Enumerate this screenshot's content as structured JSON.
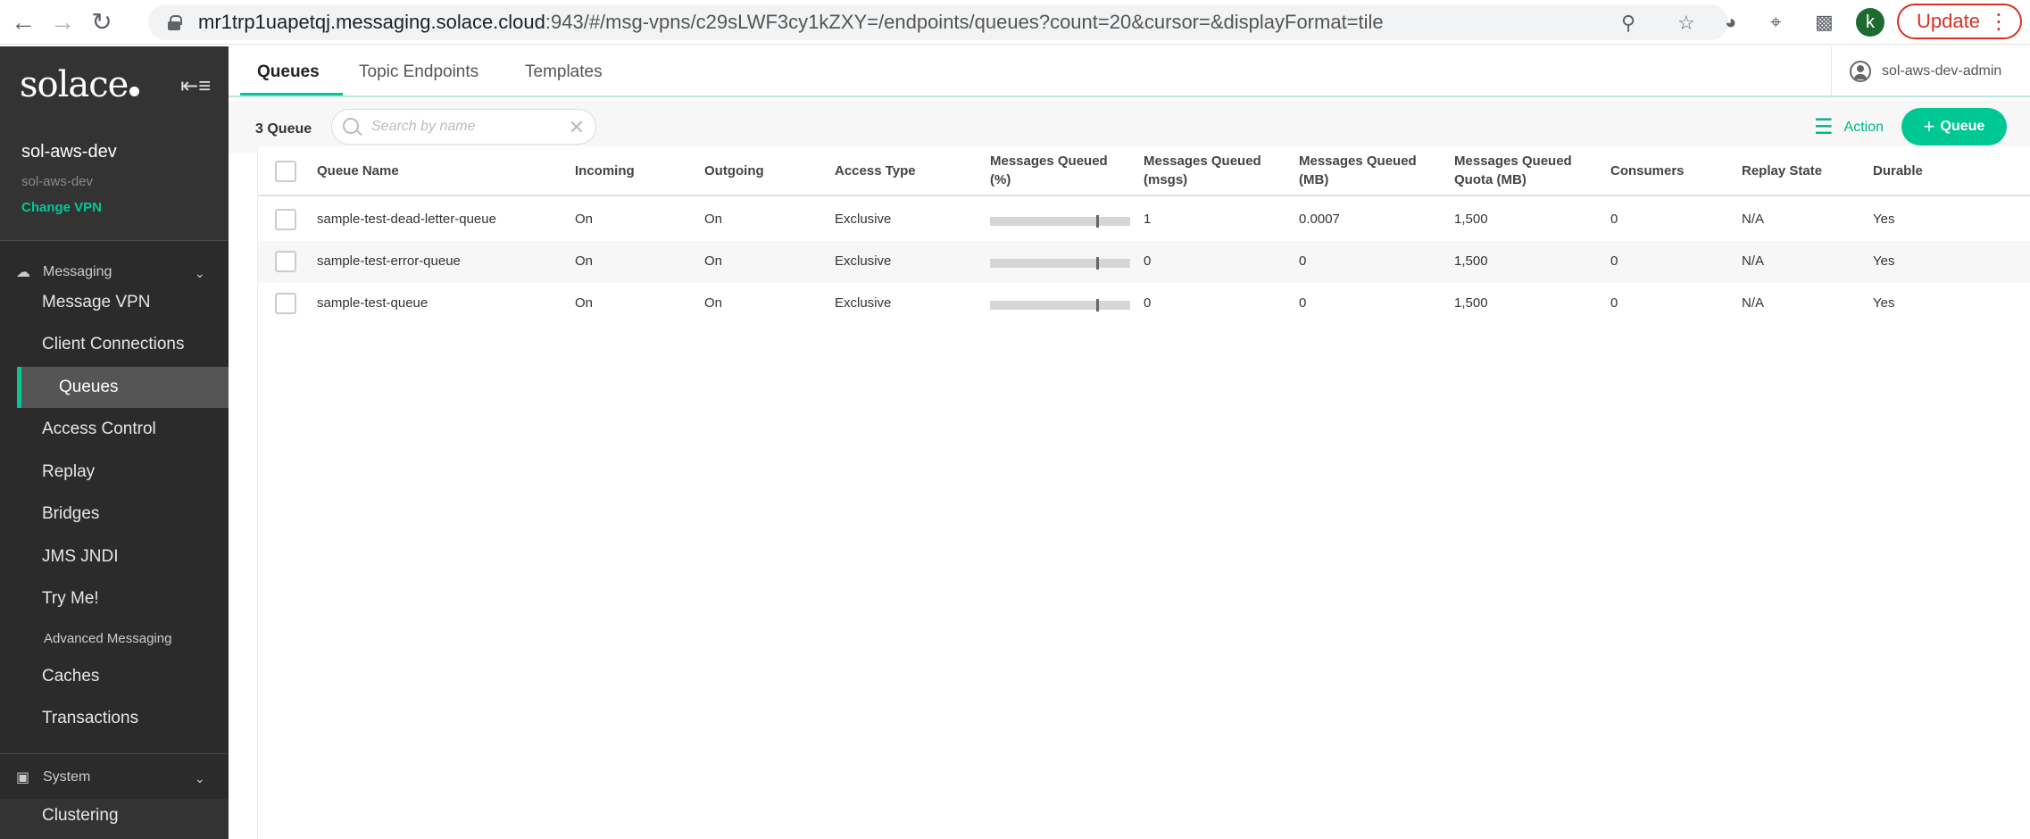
{
  "browser": {
    "url_host": "mr1trp1uapetqj.messaging.solace.cloud",
    "url_rest": ":943/#/msg-vpns/c29sLWF3cy1kZXY=/endpoints/queues?count=20&cursor=&displayFormat=tile",
    "profile_initial": "k",
    "update_label": "Update"
  },
  "sidebar": {
    "logo": "solace",
    "vpn_name": "sol-aws-dev",
    "vpn_sub": "sol-aws-dev",
    "change_vpn": "Change VPN",
    "messaging_section": "Messaging",
    "messaging_items": [
      "Message VPN",
      "Client Connections",
      "Queues",
      "Access Control",
      "Replay",
      "Bridges",
      "JMS JNDI",
      "Try Me!",
      "Advanced Messaging",
      "Caches",
      "Transactions"
    ],
    "active_item": "Queues",
    "system_section": "System",
    "system_items": [
      "Clustering"
    ]
  },
  "tabs": [
    "Queues",
    "Topic Endpoints",
    "Templates"
  ],
  "user": "sol-aws-dev-admin",
  "toolbar": {
    "count": "3 Queue",
    "search_placeholder": "Search by name",
    "action_label": "Action",
    "queue_button": "Queue"
  },
  "table": {
    "headers": [
      "Queue Name",
      "Incoming",
      "Outgoing",
      "Access Type",
      "Messages Queued (%)",
      "Messages Queued (msgs)",
      "Messages Queued (MB)",
      "Messages Queued Quota (MB)",
      "Consumers",
      "Replay State",
      "Durable"
    ],
    "header_lines": [
      [
        "Queue Name"
      ],
      [
        "Incoming"
      ],
      [
        "Outgoing"
      ],
      [
        "Access Type"
      ],
      [
        "Messages Queued",
        "(%)"
      ],
      [
        "Messages Queued",
        "(msgs)"
      ],
      [
        "Messages Queued",
        "(MB)"
      ],
      [
        "Messages Queued",
        "Quota (MB)"
      ],
      [
        "Consumers"
      ],
      [
        "Replay State"
      ],
      [
        "Durable"
      ]
    ],
    "rows": [
      {
        "name": "sample-test-dead-letter-queue",
        "incoming": "On",
        "outgoing": "On",
        "access": "Exclusive",
        "msgs": "1",
        "mb": "0.0007",
        "quota": "1,500",
        "consumers": "0",
        "replay": "N/A",
        "durable": "Yes"
      },
      {
        "name": "sample-test-error-queue",
        "incoming": "On",
        "outgoing": "On",
        "access": "Exclusive",
        "msgs": "0",
        "mb": "0",
        "quota": "1,500",
        "consumers": "0",
        "replay": "N/A",
        "durable": "Yes"
      },
      {
        "name": "sample-test-queue",
        "incoming": "On",
        "outgoing": "On",
        "access": "Exclusive",
        "msgs": "0",
        "mb": "0",
        "quota": "1,500",
        "consumers": "0",
        "replay": "N/A",
        "durable": "Yes"
      }
    ]
  },
  "colors": {
    "accent": "#00c895",
    "sidebar": "#333333",
    "update": "#d93025"
  }
}
